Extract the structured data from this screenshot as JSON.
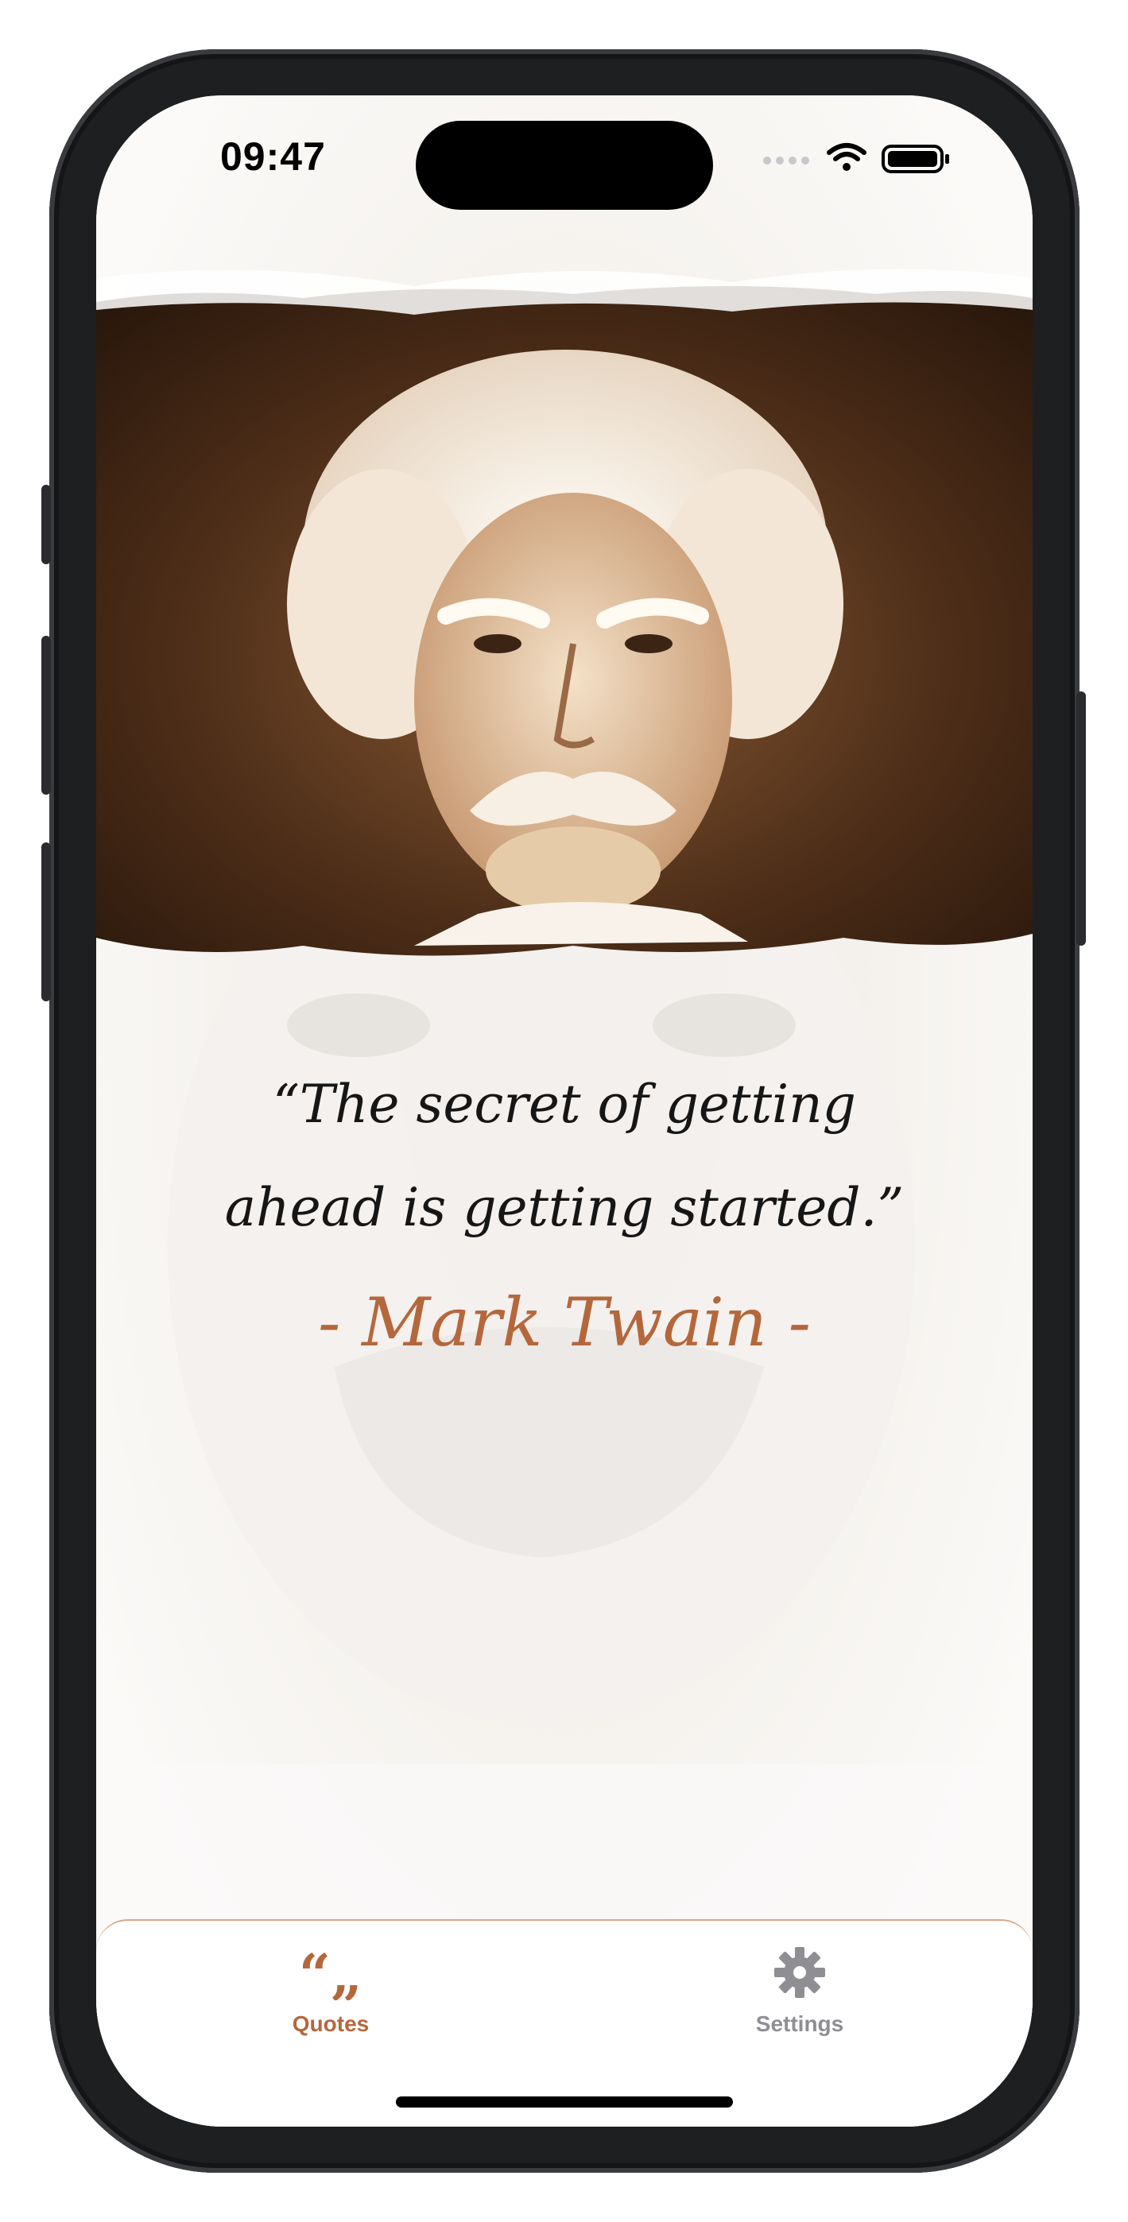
{
  "status_bar": {
    "time": "09:47",
    "icons": [
      "signal-dots-icon",
      "wifi-icon",
      "battery-icon"
    ]
  },
  "hero": {
    "description_icon": "portrait-photo"
  },
  "quote": {
    "text": "“The secret of getting ahead is getting started.”",
    "author": "- Mark Twain -"
  },
  "tabbar": {
    "tabs": [
      {
        "label": "Quotes",
        "icon": "quotes-icon",
        "active": true
      },
      {
        "label": "Settings",
        "icon": "gear-icon",
        "active": false
      }
    ]
  },
  "colors": {
    "accent": "#b5673c",
    "inactive": "#8e8e93",
    "sepia_dark": "#3a2212"
  }
}
